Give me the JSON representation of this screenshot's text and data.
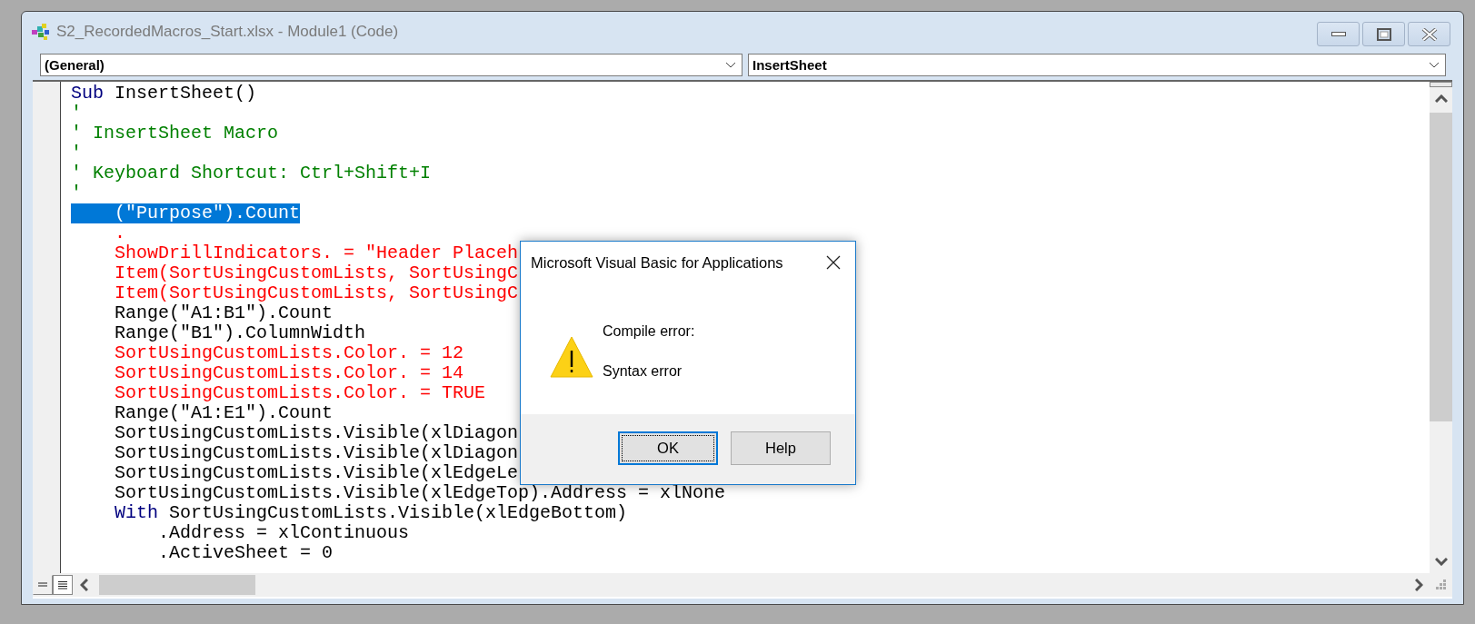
{
  "window": {
    "title": "S2_RecordedMacros_Start.xlsx - Module1 (Code)"
  },
  "object_dropdown": {
    "value": "(General)"
  },
  "procedure_dropdown": {
    "value": "InsertSheet"
  },
  "code_lines": [
    {
      "selected": false,
      "segments": [
        {
          "kind": "keyword",
          "text": "Sub"
        },
        {
          "kind": "plain",
          "text": " InsertSheet()"
        }
      ]
    },
    {
      "selected": false,
      "segments": [
        {
          "kind": "comment",
          "text": "'"
        }
      ]
    },
    {
      "selected": false,
      "segments": [
        {
          "kind": "comment",
          "text": "' InsertSheet Macro"
        }
      ]
    },
    {
      "selected": false,
      "segments": [
        {
          "kind": "comment",
          "text": "'"
        }
      ]
    },
    {
      "selected": false,
      "segments": [
        {
          "kind": "comment",
          "text": "' Keyboard Shortcut: Ctrl+Shift+I"
        }
      ]
    },
    {
      "selected": false,
      "segments": [
        {
          "kind": "comment",
          "text": "'"
        }
      ]
    },
    {
      "selected": true,
      "segments": [
        {
          "kind": "plain",
          "text": "    (\"Purpose\").Count"
        }
      ]
    },
    {
      "selected": false,
      "segments": [
        {
          "kind": "error",
          "text": "    ."
        }
      ]
    },
    {
      "selected": false,
      "segments": [
        {
          "kind": "error",
          "text": "    ShowDrillIndicators. = \"Header Placeh"
        }
      ]
    },
    {
      "selected": false,
      "segments": [
        {
          "kind": "error",
          "text": "    Item(SortUsingCustomLists, SortUsingC"
        }
      ]
    },
    {
      "selected": false,
      "segments": [
        {
          "kind": "error",
          "text": "    Item(SortUsingCustomLists, SortUsingC"
        }
      ]
    },
    {
      "selected": false,
      "segments": [
        {
          "kind": "plain",
          "text": "    Range(\"A1:B1\").Count"
        }
      ]
    },
    {
      "selected": false,
      "segments": [
        {
          "kind": "plain",
          "text": "    Range(\"B1\").ColumnWidth"
        }
      ]
    },
    {
      "selected": false,
      "segments": [
        {
          "kind": "error",
          "text": "    SortUsingCustomLists.Color. = 12"
        }
      ]
    },
    {
      "selected": false,
      "segments": [
        {
          "kind": "error",
          "text": "    SortUsingCustomLists.Color. = 14"
        }
      ]
    },
    {
      "selected": false,
      "segments": [
        {
          "kind": "error",
          "text": "    SortUsingCustomLists.Color. = TRUE"
        }
      ]
    },
    {
      "selected": false,
      "segments": [
        {
          "kind": "plain",
          "text": "    Range(\"A1:E1\").Count"
        }
      ]
    },
    {
      "selected": false,
      "segments": [
        {
          "kind": "plain",
          "text": "    SortUsingCustomLists.Visible(xlDiagon"
        }
      ]
    },
    {
      "selected": false,
      "segments": [
        {
          "kind": "plain",
          "text": "    SortUsingCustomLists.Visible(xlDiagon"
        }
      ]
    },
    {
      "selected": false,
      "segments": [
        {
          "kind": "plain",
          "text": "    SortUsingCustomLists.Visible(xlEdgeLe"
        }
      ]
    },
    {
      "selected": false,
      "segments": [
        {
          "kind": "plain",
          "text": "    SortUsingCustomLists.Visible(xlEdgeTop).Address = xlNone"
        }
      ]
    },
    {
      "selected": false,
      "segments": [
        {
          "kind": "keyword",
          "text": "    With"
        },
        {
          "kind": "plain",
          "text": " SortUsingCustomLists.Visible(xlEdgeBottom)"
        }
      ]
    },
    {
      "selected": false,
      "segments": [
        {
          "kind": "plain",
          "text": "        .Address = xlContinuous"
        }
      ]
    },
    {
      "selected": false,
      "segments": [
        {
          "kind": "plain",
          "text": "        .ActiveSheet = 0"
        }
      ]
    }
  ],
  "view_buttons": [
    {
      "selected": false
    },
    {
      "selected": true
    }
  ],
  "dialog": {
    "title": "Microsoft Visual Basic for Applications",
    "message": "Compile error:",
    "detail": "Syntax error",
    "buttons": [
      {
        "label": "OK",
        "focused": true
      },
      {
        "label": "Help",
        "focused": false
      }
    ]
  }
}
